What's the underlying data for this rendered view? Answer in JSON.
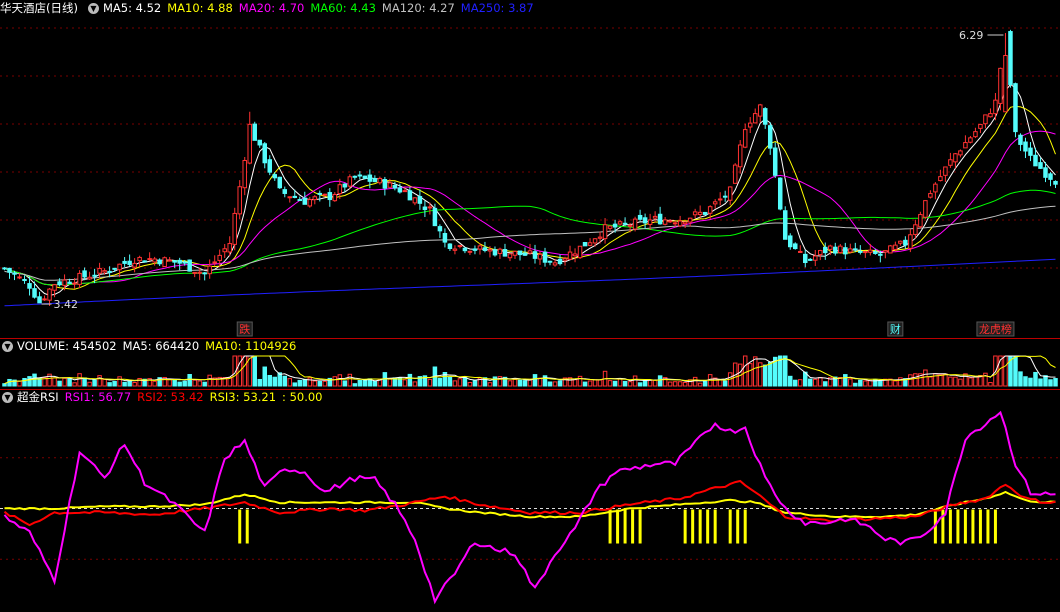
{
  "colors": {
    "up": "#ff3232",
    "down": "#54fcfc",
    "ma5": "#ffffff",
    "ma10": "#ffff00",
    "ma20": "#ff00ff",
    "ma60": "#00ff00",
    "ma120": "#c0c0c0",
    "ma250": "#2020ff",
    "grid": "#7a0000",
    "rsi1": "#ff00ff",
    "rsi2": "#ff0000",
    "rsi3": "#ffff00",
    "signal": "#ffff00"
  },
  "price_panel": {
    "title": "华天酒店(日线)",
    "items": [
      {
        "label": "MA5: 4.52",
        "color": "#ffffff"
      },
      {
        "label": "MA10: 4.88",
        "color": "#ffff00"
      },
      {
        "label": "MA20: 4.70",
        "color": "#ff00ff"
      },
      {
        "label": "MA60: 4.43",
        "color": "#00ff00"
      },
      {
        "label": "MA120: 4.27",
        "color": "#c0c0c0"
      },
      {
        "label": "MA250: 3.87",
        "color": "#2020ff"
      }
    ],
    "high_label": "6.29",
    "low_label": "3.42",
    "events": [
      {
        "text": "跌",
        "index": 48,
        "color": "#ff3232"
      },
      {
        "text": "财",
        "index": 178,
        "color": "#54fcfc"
      },
      {
        "text": "龙虎榜",
        "index": 198,
        "color": "#ff3232"
      }
    ]
  },
  "volume_panel": {
    "items": [
      {
        "label": "VOLUME: 454502",
        "color": "#ffffff"
      },
      {
        "label": "MA5: 664420",
        "color": "#ffffff"
      },
      {
        "label": "MA10: 1104926",
        "color": "#ffff00"
      }
    ]
  },
  "rsi_panel": {
    "title": "超金RSI",
    "items": [
      {
        "label": "RSI1: 56.77",
        "color": "#ff00ff"
      },
      {
        "label": "RSI2: 53.42",
        "color": "#ff0000"
      },
      {
        "label": "RSI3: 53.21",
        "color": "#ffff00"
      },
      {
        "label": ": 50.00",
        "color": "#ffff00"
      }
    ]
  },
  "chart_data": {
    "type": "candlestick",
    "count": 211,
    "y_range": [
      3.25,
      6.45
    ],
    "volume_max": 3300000,
    "rsi_range": [
      0,
      100
    ],
    "rsi_mid": 50,
    "price_keys": [
      [
        0,
        3.78
      ],
      [
        5,
        3.6
      ],
      [
        7,
        3.42
      ],
      [
        10,
        3.62
      ],
      [
        15,
        3.68
      ],
      [
        20,
        3.75
      ],
      [
        26,
        3.88
      ],
      [
        30,
        3.88
      ],
      [
        35,
        3.84
      ],
      [
        40,
        3.72
      ],
      [
        45,
        4.05
      ],
      [
        47,
        4.65
      ],
      [
        49,
        5.3
      ],
      [
        51,
        5.05
      ],
      [
        55,
        4.6
      ],
      [
        60,
        4.5
      ],
      [
        65,
        4.55
      ],
      [
        70,
        4.75
      ],
      [
        75,
        4.7
      ],
      [
        80,
        4.6
      ],
      [
        85,
        4.4
      ],
      [
        88,
        4.05
      ],
      [
        95,
        3.98
      ],
      [
        100,
        3.95
      ],
      [
        105,
        3.92
      ],
      [
        110,
        3.85
      ],
      [
        115,
        4.0
      ],
      [
        120,
        4.2
      ],
      [
        125,
        4.25
      ],
      [
        130,
        4.3
      ],
      [
        135,
        4.3
      ],
      [
        140,
        4.38
      ],
      [
        145,
        4.6
      ],
      [
        148,
        5.3
      ],
      [
        151,
        5.5
      ],
      [
        153,
        5.1
      ],
      [
        156,
        4.1
      ],
      [
        160,
        3.85
      ],
      [
        165,
        4.0
      ],
      [
        170,
        3.95
      ],
      [
        175,
        3.92
      ],
      [
        180,
        4.05
      ],
      [
        185,
        4.6
      ],
      [
        190,
        5.0
      ],
      [
        195,
        5.3
      ],
      [
        198,
        5.55
      ],
      [
        200,
        6.29
      ],
      [
        202,
        5.2
      ],
      [
        205,
        4.95
      ],
      [
        208,
        4.8
      ],
      [
        210,
        4.72
      ]
    ],
    "ma_periods": [
      5,
      10,
      20,
      60,
      120,
      250
    ],
    "rsi1_keys": [
      [
        0,
        46
      ],
      [
        5,
        38
      ],
      [
        10,
        15
      ],
      [
        15,
        78
      ],
      [
        20,
        65
      ],
      [
        24,
        82
      ],
      [
        28,
        63
      ],
      [
        34,
        52
      ],
      [
        40,
        38
      ],
      [
        44,
        75
      ],
      [
        48,
        83
      ],
      [
        52,
        60
      ],
      [
        56,
        70
      ],
      [
        60,
        68
      ],
      [
        64,
        58
      ],
      [
        70,
        65
      ],
      [
        74,
        64
      ],
      [
        78,
        52
      ],
      [
        82,
        35
      ],
      [
        86,
        5
      ],
      [
        90,
        18
      ],
      [
        94,
        34
      ],
      [
        98,
        30
      ],
      [
        102,
        28
      ],
      [
        106,
        10
      ],
      [
        110,
        28
      ],
      [
        114,
        40
      ],
      [
        118,
        58
      ],
      [
        122,
        68
      ],
      [
        126,
        70
      ],
      [
        130,
        72
      ],
      [
        134,
        72
      ],
      [
        138,
        82
      ],
      [
        142,
        92
      ],
      [
        145,
        88
      ],
      [
        148,
        90
      ],
      [
        152,
        65
      ],
      [
        156,
        50
      ],
      [
        160,
        43
      ],
      [
        164,
        43
      ],
      [
        168,
        45
      ],
      [
        172,
        42
      ],
      [
        176,
        35
      ],
      [
        180,
        33
      ],
      [
        184,
        38
      ],
      [
        188,
        48
      ],
      [
        192,
        85
      ],
      [
        196,
        92
      ],
      [
        199,
        98
      ],
      [
        202,
        72
      ],
      [
        205,
        58
      ],
      [
        208,
        57
      ],
      [
        210,
        56.77
      ]
    ],
    "rsi2_keys": [
      [
        0,
        48
      ],
      [
        5,
        42
      ],
      [
        10,
        48
      ],
      [
        20,
        48
      ],
      [
        30,
        47
      ],
      [
        40,
        50
      ],
      [
        48,
        53
      ],
      [
        55,
        48
      ],
      [
        65,
        50
      ],
      [
        72,
        49
      ],
      [
        80,
        52
      ],
      [
        88,
        56
      ],
      [
        95,
        52
      ],
      [
        105,
        48
      ],
      [
        115,
        48
      ],
      [
        125,
        52
      ],
      [
        135,
        55
      ],
      [
        142,
        60
      ],
      [
        147,
        63
      ],
      [
        150,
        58
      ],
      [
        156,
        46
      ],
      [
        164,
        44
      ],
      [
        174,
        45
      ],
      [
        182,
        46
      ],
      [
        190,
        52
      ],
      [
        196,
        55
      ],
      [
        200,
        62
      ],
      [
        204,
        55
      ],
      [
        208,
        53
      ],
      [
        210,
        53.42
      ]
    ],
    "rsi3_keys": [
      [
        0,
        50
      ],
      [
        10,
        50
      ],
      [
        20,
        51
      ],
      [
        30,
        51
      ],
      [
        40,
        52
      ],
      [
        48,
        57
      ],
      [
        55,
        53
      ],
      [
        65,
        53
      ],
      [
        75,
        53
      ],
      [
        82,
        53
      ],
      [
        88,
        50
      ],
      [
        95,
        48
      ],
      [
        105,
        46
      ],
      [
        115,
        46
      ],
      [
        125,
        50
      ],
      [
        135,
        52
      ],
      [
        145,
        54
      ],
      [
        150,
        53
      ],
      [
        156,
        48
      ],
      [
        166,
        46
      ],
      [
        176,
        46
      ],
      [
        182,
        47
      ],
      [
        190,
        52
      ],
      [
        196,
        55
      ],
      [
        200,
        58
      ],
      [
        204,
        54
      ],
      [
        208,
        53
      ],
      [
        210,
        53.21
      ]
    ],
    "signals": [
      [
        47,
        49
      ],
      [
        121,
        123
      ],
      [
        124,
        128
      ],
      [
        136,
        143
      ],
      [
        145,
        148
      ],
      [
        186,
        198
      ]
    ]
  }
}
